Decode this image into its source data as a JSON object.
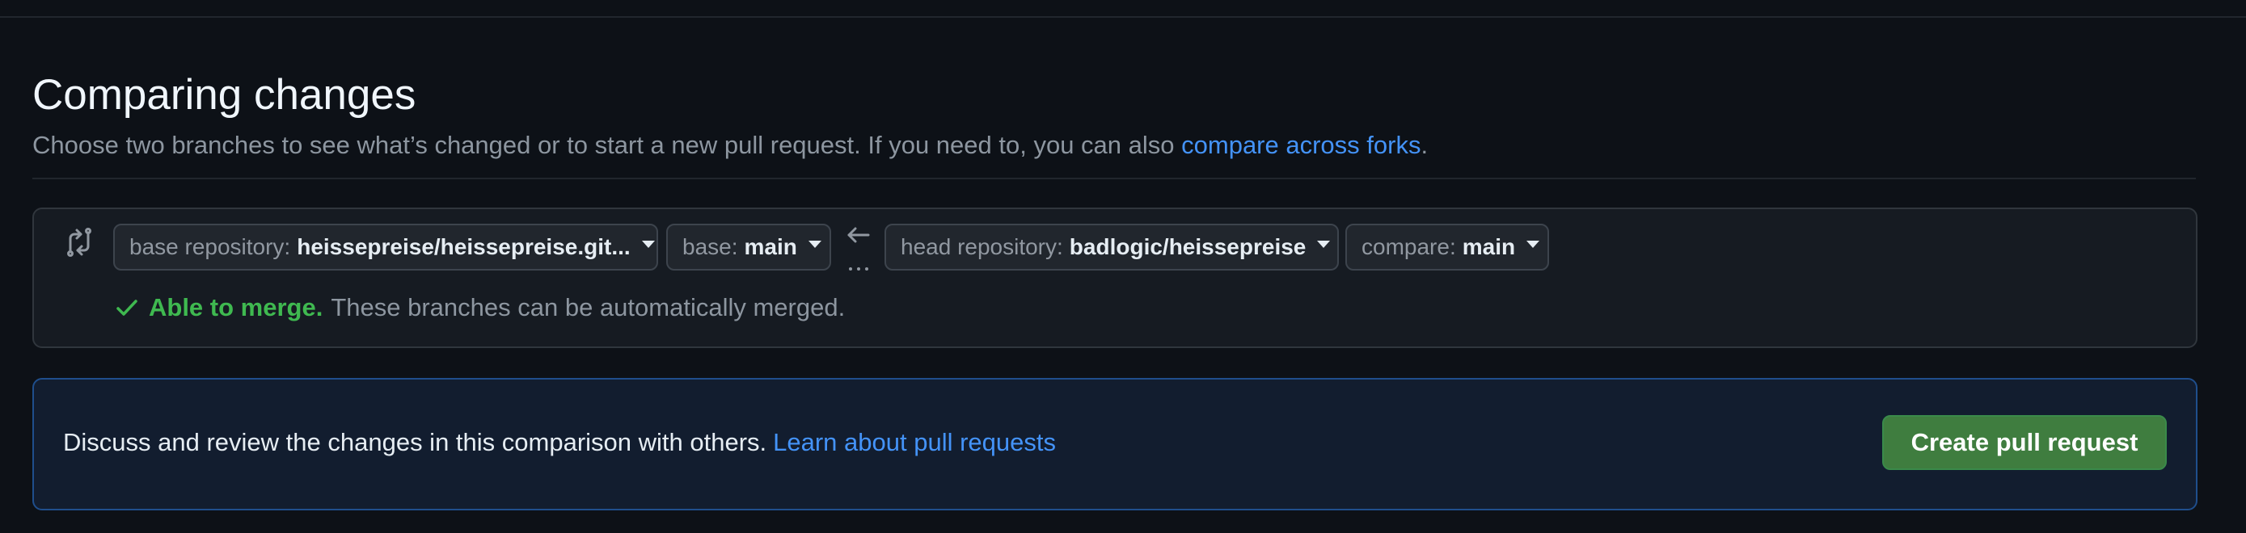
{
  "header": {
    "title": "Comparing changes",
    "subtitle": "Choose two branches to see what’s changed or to start a new pull request. If you need to, you can also",
    "subtitle_link": "compare across forks",
    "subtitle_end": "."
  },
  "compare": {
    "icon": "git-compare-icon",
    "base_repo_label": "base repository:",
    "base_repo_value": "heissepreise/heissepreise.git...",
    "base_label": "base:",
    "base_value": "main",
    "arrow_icon": "arrow-left-icon",
    "head_repo_label": "head repository:",
    "head_repo_value": "badlogic/heissepreise",
    "compare_label": "compare:",
    "compare_value": "main",
    "merge_ok": "Able to merge.",
    "merge_desc": "These branches can be automatically merged."
  },
  "discuss": {
    "text": "Discuss and review the changes in this comparison with others.",
    "link": "Learn about pull requests",
    "button": "Create pull request"
  },
  "colors": {
    "background": "#0d1117",
    "link": "#4493f8",
    "success": "#3fb950",
    "primary_button": "#3f7d3f"
  }
}
